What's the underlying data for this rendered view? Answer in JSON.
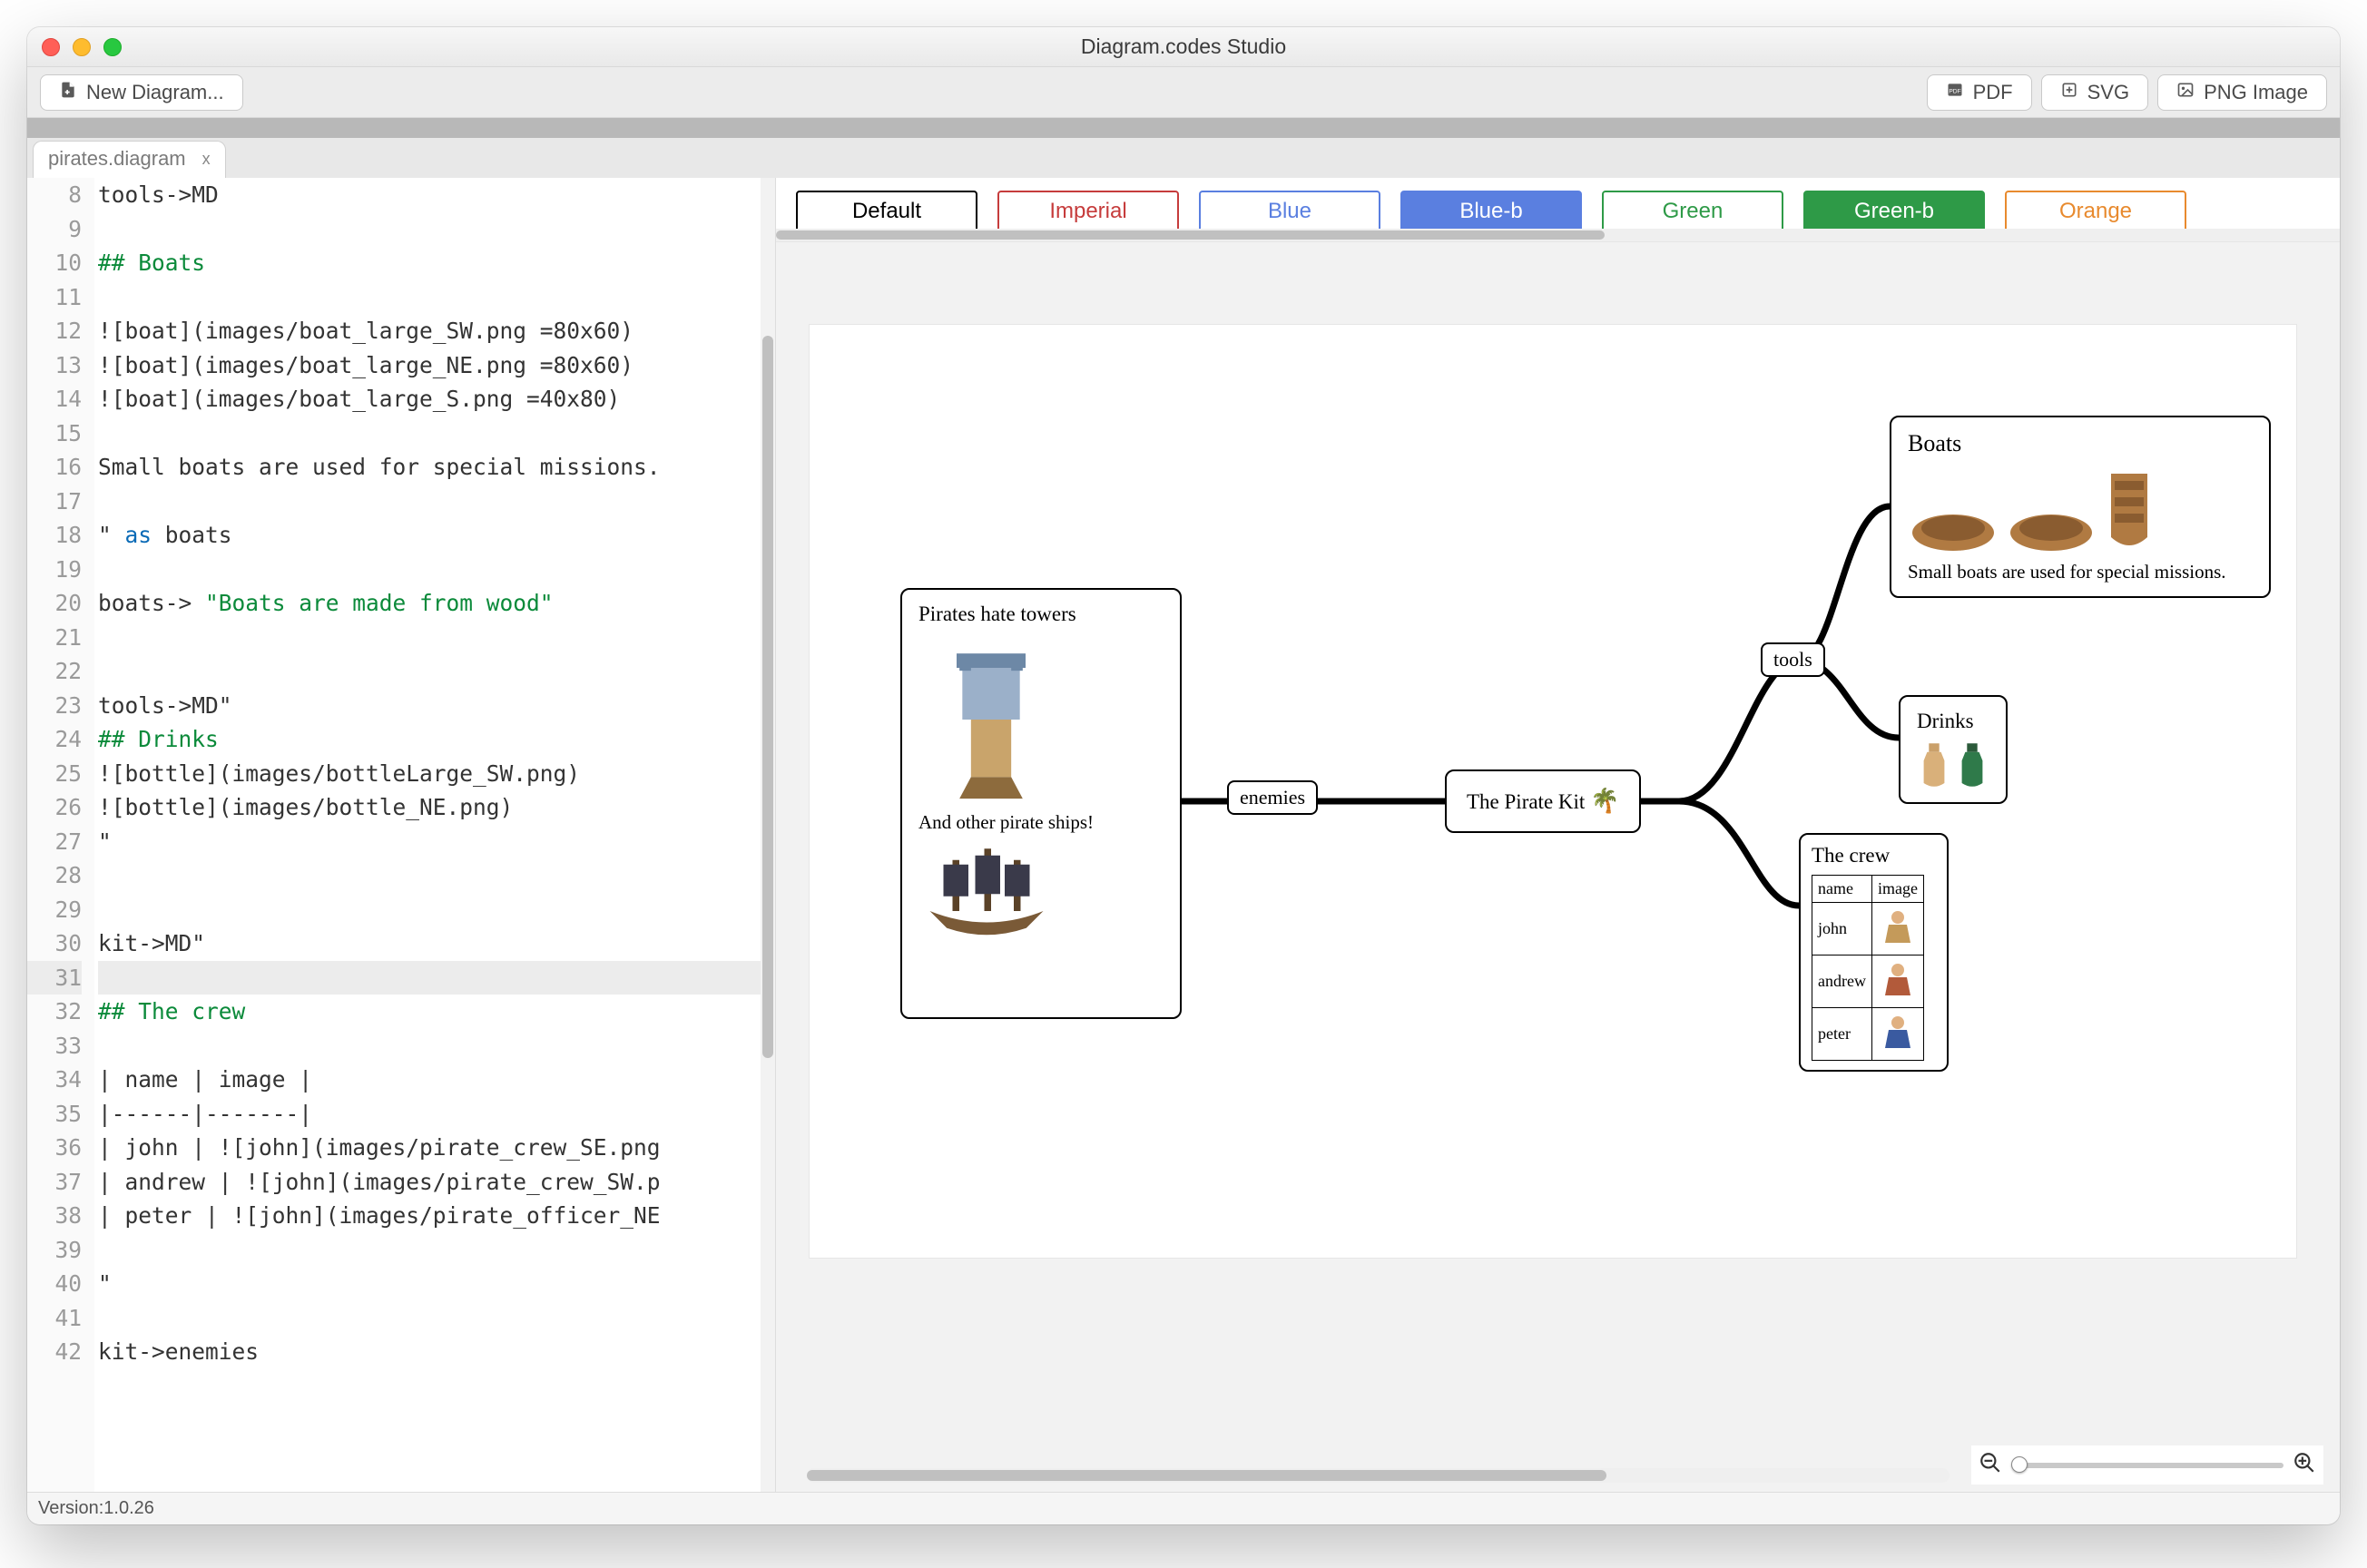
{
  "window": {
    "title": "Diagram.codes Studio"
  },
  "toolbar": {
    "new_diagram": "New Diagram...",
    "pdf": "PDF",
    "svg": "SVG",
    "png": "PNG Image"
  },
  "tab": {
    "name": "pirates.diagram",
    "close": "x"
  },
  "editor": {
    "first_line_number": 8,
    "active_line": 31,
    "lines": [
      {
        "n": 8,
        "raw": "tools->MD"
      },
      {
        "n": 9,
        "raw": ""
      },
      {
        "n": 10,
        "raw": "## Boats",
        "head": true
      },
      {
        "n": 11,
        "raw": ""
      },
      {
        "n": 12,
        "raw": "![boat](images/boat_large_SW.png =80x60)"
      },
      {
        "n": 13,
        "raw": "![boat](images/boat_large_NE.png =80x60)"
      },
      {
        "n": 14,
        "raw": "![boat](images/boat_large_S.png =40x80)"
      },
      {
        "n": 15,
        "raw": ""
      },
      {
        "n": 16,
        "raw": "Small boats are used for special missions."
      },
      {
        "n": 17,
        "raw": ""
      },
      {
        "n": 18,
        "raw": "\" as boats",
        "kw": "as"
      },
      {
        "n": 19,
        "raw": ""
      },
      {
        "n": 20,
        "raw": "boats-> \"Boats are made from wood\"",
        "str": "\"Boats are made from wood\""
      },
      {
        "n": 21,
        "raw": ""
      },
      {
        "n": 22,
        "raw": ""
      },
      {
        "n": 23,
        "raw": "tools->MD\""
      },
      {
        "n": 24,
        "raw": "## Drinks",
        "head": true
      },
      {
        "n": 25,
        "raw": "![bottle](images/bottleLarge_SW.png)"
      },
      {
        "n": 26,
        "raw": "![bottle](images/bottle_NE.png)"
      },
      {
        "n": 27,
        "raw": "\""
      },
      {
        "n": 28,
        "raw": ""
      },
      {
        "n": 29,
        "raw": ""
      },
      {
        "n": 30,
        "raw": "kit->MD\""
      },
      {
        "n": 31,
        "raw": ""
      },
      {
        "n": 32,
        "raw": "## The crew",
        "head": true
      },
      {
        "n": 33,
        "raw": ""
      },
      {
        "n": 34,
        "raw": "| name | image |"
      },
      {
        "n": 35,
        "raw": "|------|-------|"
      },
      {
        "n": 36,
        "raw": "| john | ![john](images/pirate_crew_SE.png"
      },
      {
        "n": 37,
        "raw": "| andrew | ![john](images/pirate_crew_SW.p"
      },
      {
        "n": 38,
        "raw": "| peter | ![john](images/pirate_officer_NE"
      },
      {
        "n": 39,
        "raw": ""
      },
      {
        "n": 40,
        "raw": "\""
      },
      {
        "n": 41,
        "raw": ""
      },
      {
        "n": 42,
        "raw": "kit->enemies"
      }
    ]
  },
  "themes": [
    {
      "label": "Default",
      "border": "#000000",
      "fg": "#000000",
      "bg": "#ffffff"
    },
    {
      "label": "Imperial",
      "border": "#c63c3c",
      "fg": "#c63c3c",
      "bg": "#ffffff"
    },
    {
      "label": "Blue",
      "border": "#5a7fe0",
      "fg": "#5a7fe0",
      "bg": "#ffffff"
    },
    {
      "label": "Blue-b",
      "border": "#5a7fe0",
      "fg": "#ffffff",
      "bg": "#5a7fe0"
    },
    {
      "label": "Green",
      "border": "#2e9a47",
      "fg": "#2e9a47",
      "bg": "#ffffff"
    },
    {
      "label": "Green-b",
      "border": "#2e9a47",
      "fg": "#ffffff",
      "bg": "#2e9a47"
    },
    {
      "label": "Orange",
      "border": "#e88a2e",
      "fg": "#e88a2e",
      "bg": "#ffffff"
    }
  ],
  "diagram": {
    "enemies": {
      "title": "Pirates hate towers",
      "subtitle": "And other pirate ships!"
    },
    "edge_enemies": "enemies",
    "center": "The Pirate Kit",
    "edge_tools": "tools",
    "boats": {
      "title": "Boats",
      "caption": "Small boats are used for special missions."
    },
    "drinks": {
      "title": "Drinks"
    },
    "crew": {
      "title": "The crew",
      "headers": [
        "name",
        "image"
      ],
      "rows": [
        {
          "name": "john"
        },
        {
          "name": "andrew"
        },
        {
          "name": "peter"
        }
      ]
    }
  },
  "status": {
    "version": "Version:1.0.26"
  }
}
